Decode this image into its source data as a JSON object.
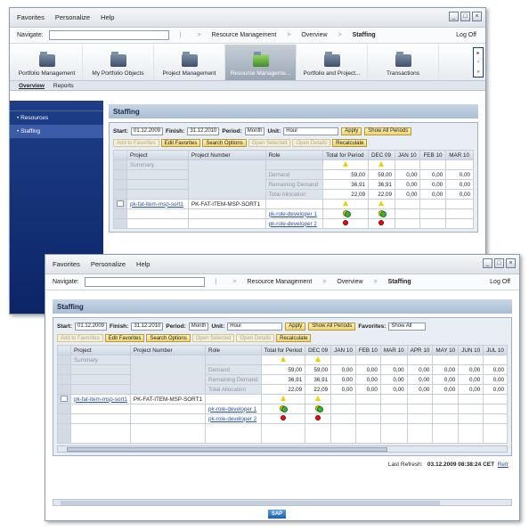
{
  "menu": [
    "Favorites",
    "Personalize",
    "Help"
  ],
  "window_controls": [
    "_",
    "□",
    "×"
  ],
  "navigate_label": "Navigate:",
  "breadcrumb": [
    "Resource Management",
    "Overview",
    "Staffing"
  ],
  "logoff": "Log Off",
  "tabs": [
    "Portfolio Management",
    "My Portfolio Objects",
    "Project Management",
    "Resource Manageme...",
    "Portfolio and Project...",
    "Transactions"
  ],
  "subnav": [
    "Overview",
    "Reports"
  ],
  "sidebar_items": [
    "Resources",
    "Staffing"
  ],
  "panel_title": "Staffing",
  "filters": {
    "start_label": "Start:",
    "start": "01.12.2009",
    "finish_label": "Finish:",
    "finish_w1": "31.12.2010",
    "finish_w2": "31.12.2010",
    "period_label": "Period:",
    "period_w1": "Month",
    "period_w2": "Month",
    "unit_label": "Unit:",
    "unit": "Hour",
    "apply": "Apply",
    "show_all": "Show All Periods",
    "favorites_label": "Favorites:",
    "favorites_value": "Show All"
  },
  "toolbar": [
    "Add to Favorites",
    "Edit Favorites",
    "Search Options",
    "Open Selected",
    "Open Details",
    "Recalculate"
  ],
  "columns_fixed": [
    "Project",
    "Project Number",
    "Role",
    "Total for Period"
  ],
  "months_w1": [
    "DEC 09",
    "JAN 10",
    "FEB 10",
    "MAR 10"
  ],
  "months_w2": [
    "DEC 09",
    "JAN 10",
    "FEB 10",
    "MAR 10",
    "APR 10",
    "MAY 10",
    "JUN 10",
    "JUL 10"
  ],
  "summary_label": "Summary",
  "summary_rows": [
    {
      "role": "Demand",
      "total": "59,00",
      "dec": "59,00"
    },
    {
      "role": "Remaining Demand",
      "total": "36,91",
      "dec": "36,91"
    },
    {
      "role": "Total Allocation",
      "total": "22,09",
      "dec": "22,09"
    }
  ],
  "zero": "0,00",
  "project": {
    "name": "pk-fat-item-msp-sort1",
    "number": "PK-FAT-ITEM-MSP-SORT1"
  },
  "role_links": [
    "pk-role-developer 1",
    "pk-role-developer 2"
  ],
  "last_refresh_label": "Last Refresh:",
  "last_refresh": "03.12.2009 08:38:24 CET",
  "refresh_link": "Refr",
  "sap_logo": "SAP"
}
